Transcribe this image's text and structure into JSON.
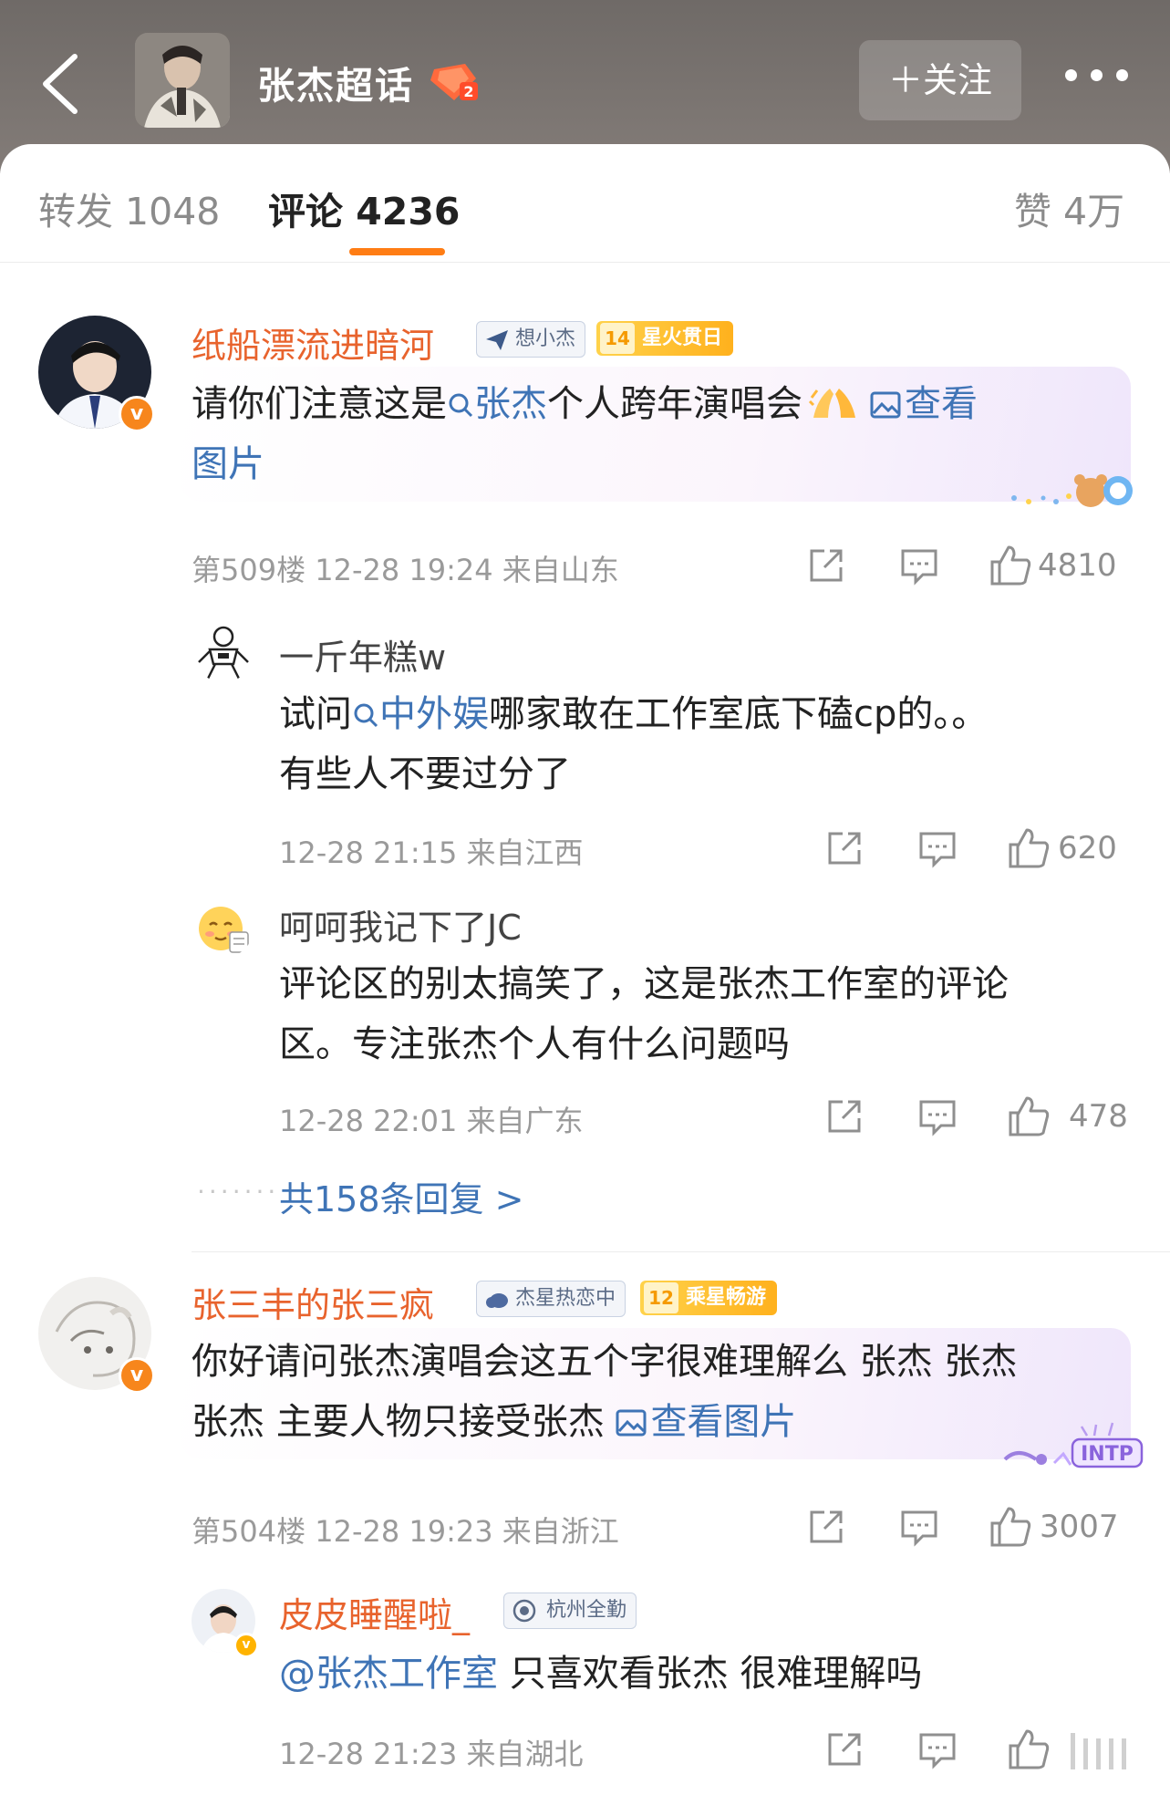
{
  "header": {
    "title": "张杰超话",
    "follow_label": "＋关注"
  },
  "tabs": {
    "repost": "转发 1048",
    "comments": "评论 4236",
    "likes": "赞 4万"
  },
  "comments": [
    {
      "user": "纸船漂流进暗河",
      "tag1": "想小杰",
      "tag2_level": "14",
      "tag2_text": "星火贯日",
      "text_pre": "请你们注意这是",
      "text_topic": "张杰",
      "text_mid": "个人跨年演唱会",
      "text_link": "查看图片",
      "link_line1": "查看",
      "link_line2": "图片",
      "meta": "第509楼 12-28 19:24 来自山东",
      "likes": "4810",
      "replies": [
        {
          "user": "一斤年糕w",
          "text_pre": "试问",
          "text_topic": "中外娱",
          "text_post1": "哪家敢在工作室底下磕cp的。。",
          "text_post2": "有些人不要过分了",
          "meta": "12-28 21:15 来自江西",
          "likes": "620"
        },
        {
          "user": "呵呵我记下了JC",
          "line1": "评论区的别太搞笑了，这是张杰工作室的评论",
          "line2": "区。专注张杰个人有什么问题吗",
          "meta": "12-28 22:01 来自广东",
          "likes": "478"
        }
      ],
      "more_replies": "共158条回复 >"
    },
    {
      "user": "张三丰的张三疯",
      "tag1": "杰星热恋中",
      "tag2_level": "12",
      "tag2_text": "乘星畅游",
      "line1": "你好请问张杰演唱会这五个字很难理解么 张杰 张杰",
      "line2_pre": "张杰 主要人物只接受张杰",
      "text_link": "查看图片",
      "sticker_text": "INTP",
      "meta": "第504楼 12-28 19:23 来自浙江",
      "likes": "3007",
      "replies": [
        {
          "user": "皮皮睡醒啦_",
          "tag1": "杭州全勤",
          "mention": "@张杰工作室",
          "text_post": " 只喜欢看张杰 很难理解吗",
          "meta": "12-28 21:23 来自湖北"
        }
      ]
    }
  ],
  "colors": {
    "accent_orange": "#ff7d14",
    "username_orange": "#e8632d",
    "link_blue": "#3f74b6",
    "header_bg": "#78726e"
  }
}
